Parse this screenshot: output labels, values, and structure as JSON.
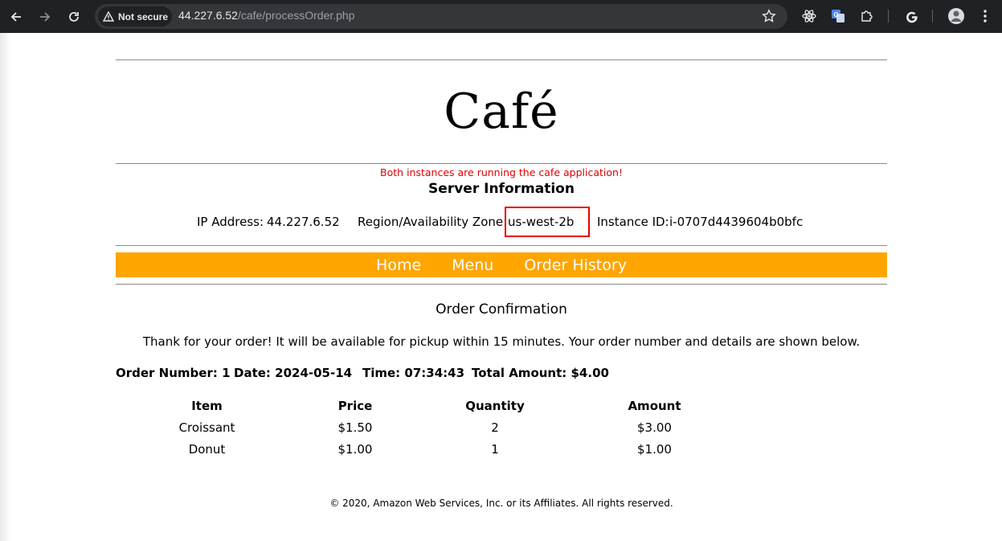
{
  "browser": {
    "security_label": "Not secure",
    "url_host": "44.227.6.52",
    "url_path": "/cafe/processOrder.php"
  },
  "site": {
    "title": "Café",
    "notice": "Both instances are running the cafe application!",
    "notice_color": "#e00000",
    "accent_color": "#ffa500"
  },
  "server": {
    "heading": "Server Information",
    "ip_label": "IP Address:",
    "ip_value": "44.227.6.52",
    "region_label": "Region/Availability Zone:",
    "region_value": "us-west-2b",
    "instance_label": "Instance ID:",
    "instance_value": "i-0707d4439604b0bfc"
  },
  "nav": {
    "home": "Home",
    "menu": "Menu",
    "history": "Order History"
  },
  "order": {
    "heading": "Order Confirmation",
    "thanks": "Thank for your order! It will be available for pickup within 15 minutes. Your order number and details are shown below.",
    "number": "Order Number: 1",
    "date": "Date: 2024-05-14",
    "time": "Time: 07:34:43",
    "total": "Total Amount: $4.00",
    "columns": [
      "Item",
      "Price",
      "Quantity",
      "Amount"
    ],
    "rows": [
      [
        "Croissant",
        "$1.50",
        "2",
        "$3.00"
      ],
      [
        "Donut",
        "$1.00",
        "1",
        "$1.00"
      ]
    ]
  },
  "footer": "© 2020, Amazon Web Services, Inc. or its Affiliates. All rights reserved."
}
